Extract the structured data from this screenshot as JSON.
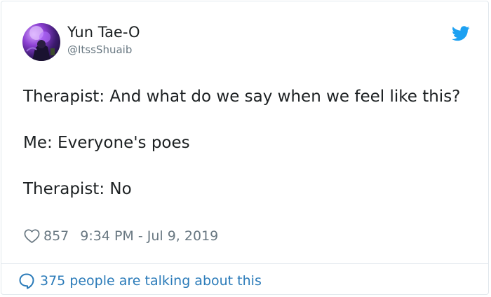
{
  "tweet": {
    "author": {
      "display_name": "Yun Tae-O",
      "handle": "@ItssShuaib",
      "avatar_icon": "profile-photo"
    },
    "brand_icon": "twitter-bird-icon",
    "brand_color": "#1da1f2",
    "paragraphs": [
      "Therapist: And what do we say when we feel like this?",
      "Me: Everyone's poes",
      "Therapist: No"
    ],
    "likes": "857",
    "timestamp": "9:34 PM - Jul 9, 2019",
    "footer_text": "375 people are talking about this",
    "link_color": "#2b7bb9",
    "muted_color": "#697882"
  }
}
